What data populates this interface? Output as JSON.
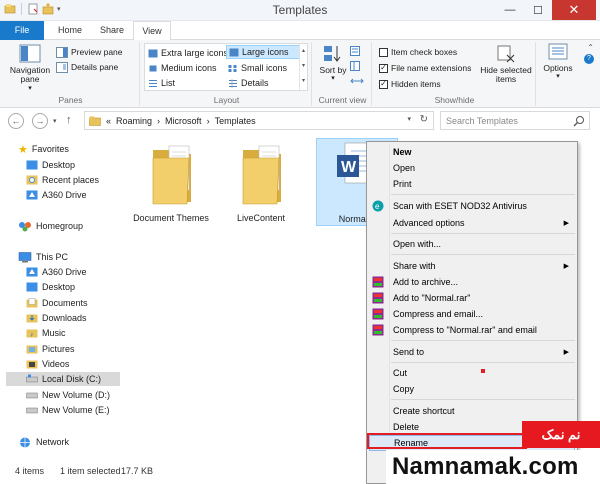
{
  "window": {
    "title": "Templates"
  },
  "tabs": {
    "file": "File",
    "home": "Home",
    "share": "Share",
    "view": "View"
  },
  "ribbon": {
    "panes": {
      "label": "Panes",
      "navigation_pane": "Navigation pane",
      "preview_pane": "Preview pane",
      "details_pane": "Details pane"
    },
    "layout": {
      "label": "Layout",
      "extra_large_icons": "Extra large icons",
      "large_icons": "Large icons",
      "medium_icons": "Medium icons",
      "small_icons": "Small icons",
      "list": "List",
      "details": "Details",
      "selected": "Large icons"
    },
    "current_view": {
      "label": "Current view",
      "sort_by": "Sort by"
    },
    "show_hide": {
      "label": "Show/hide",
      "item_check_boxes": {
        "text": "Item check boxes",
        "checked": false
      },
      "file_name_extensions": {
        "text": "File name extensions",
        "checked": true
      },
      "hidden_items": {
        "text": "Hidden items",
        "checked": true
      },
      "hide_selected_items": "Hide selected items"
    },
    "options": "Options"
  },
  "address": {
    "overflow": "«",
    "path": [
      "Roaming",
      "Microsoft",
      "Templates"
    ],
    "search_placeholder": "Search Templates"
  },
  "nav": {
    "favorites": "Favorites",
    "favorites_items": [
      "Desktop",
      "Recent places",
      "A360 Drive"
    ],
    "homegroup": "Homegroup",
    "this_pc": "This PC",
    "pc_items": [
      "A360 Drive",
      "Desktop",
      "Documents",
      "Downloads",
      "Music",
      "Pictures",
      "Videos",
      "Local Disk (C:)",
      "New Volume (D:)",
      "New Volume (E:)"
    ],
    "selected": "Local Disk (C:)",
    "network": "Network"
  },
  "files": [
    {
      "name": "Document Themes",
      "type": "folder"
    },
    {
      "name": "LiveContent",
      "type": "folder"
    },
    {
      "name": "Normal.d",
      "type": "word",
      "selected": true
    }
  ],
  "status": {
    "items": "4 items",
    "selected": "1 item selected",
    "size": "17.7 KB"
  },
  "context_menu": {
    "new": "New",
    "open": "Open",
    "print": "Print",
    "scan": "Scan with ESET NOD32 Antivirus",
    "advanced": "Advanced options",
    "open_with": "Open with...",
    "share_with": "Share with",
    "add_archive": "Add to archive...",
    "add_rar": "Add to \"Normal.rar\"",
    "compress_email": "Compress and email...",
    "compress_rar_email": "Compress to \"Normal.rar\" and email",
    "send_to": "Send to",
    "cut": "Cut",
    "copy": "Copy",
    "create_shortcut": "Create shortcut",
    "delete": "Delete",
    "rename": "Rename",
    "properties_partial": "Pr"
  },
  "watermark": {
    "persian": "نم نمک",
    "site": "Namnamak.com"
  },
  "colors": {
    "accent": "#1979ca",
    "selection": "#cce8ff",
    "highlight_red": "#e21d24"
  }
}
